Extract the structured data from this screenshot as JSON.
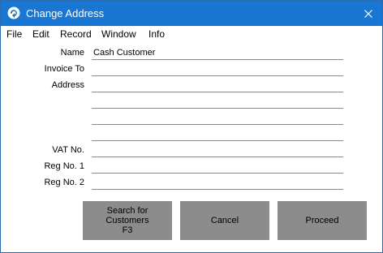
{
  "window": {
    "title": "Change Address",
    "colors": {
      "titlebar": "#1976d2",
      "button": "#8c8c8c"
    }
  },
  "menu": [
    "File",
    "Edit",
    "Record",
    "Window",
    "Info"
  ],
  "form": {
    "name": {
      "label": "Name",
      "value": "Cash Customer"
    },
    "invoice_to": {
      "label": "Invoice To",
      "value": ""
    },
    "address": {
      "label": "Address",
      "lines": [
        "",
        "",
        "",
        ""
      ]
    },
    "vat_no": {
      "label": "VAT No.",
      "value": ""
    },
    "reg_no_1": {
      "label": "Reg No. 1",
      "value": ""
    },
    "reg_no_2": {
      "label": "Reg No. 2",
      "value": ""
    }
  },
  "buttons": {
    "search": "Search for\nCustomers\nF3",
    "cancel": "Cancel",
    "proceed": "Proceed"
  }
}
